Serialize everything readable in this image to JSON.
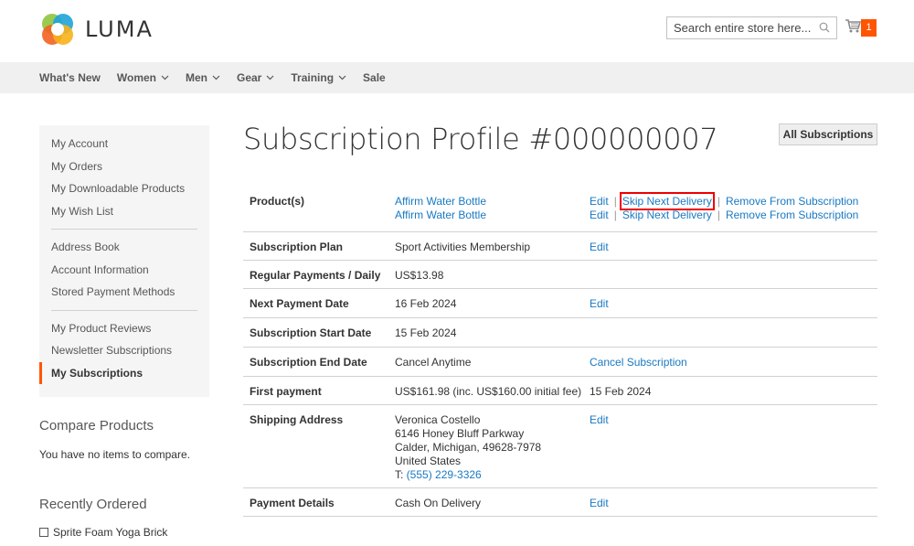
{
  "header": {
    "logo_text": "LUMA",
    "search_placeholder": "Search entire store here...",
    "cart_count": "1"
  },
  "nav": {
    "items": [
      {
        "label": "What's New",
        "dropdown": false
      },
      {
        "label": "Women",
        "dropdown": true
      },
      {
        "label": "Men",
        "dropdown": true
      },
      {
        "label": "Gear",
        "dropdown": true
      },
      {
        "label": "Training",
        "dropdown": true
      },
      {
        "label": "Sale",
        "dropdown": false
      }
    ]
  },
  "sidebar": {
    "group1": [
      "My Account",
      "My Orders",
      "My Downloadable Products",
      "My Wish List"
    ],
    "group2": [
      "Address Book",
      "Account Information",
      "Stored Payment Methods"
    ],
    "group3": [
      "My Product Reviews",
      "Newsletter Subscriptions",
      "My Subscriptions"
    ],
    "active": "My Subscriptions"
  },
  "compare": {
    "title": "Compare Products",
    "text": "You have no items to compare."
  },
  "recent": {
    "title": "Recently Ordered",
    "item": "Sprite Foam Yoga Brick"
  },
  "main": {
    "title": "Subscription Profile #000000007",
    "all_subscriptions_label": "All Subscriptions",
    "products_label": "Product(s)",
    "products": [
      {
        "name": "Affirm Water Bottle",
        "edit": "Edit",
        "skip": "Skip Next Delivery",
        "remove": "Remove From Subscription"
      },
      {
        "name": "Affirm Water Bottle",
        "edit": "Edit",
        "skip": "Skip Next Delivery",
        "remove": "Remove From Subscription"
      }
    ],
    "plan_label": "Subscription Plan",
    "plan_value": "Sport Activities Membership",
    "plan_action": "Edit",
    "regular_label": "Regular Payments / Daily",
    "regular_value": "US$13.98",
    "next_label": "Next Payment Date",
    "next_value": "16 Feb 2024",
    "next_action": "Edit",
    "start_label": "Subscription Start Date",
    "start_value": "15 Feb 2024",
    "end_label": "Subscription End Date",
    "end_value": "Cancel Anytime",
    "end_action": "Cancel Subscription",
    "first_label": "First payment",
    "first_value": "US$161.98 (inc. US$160.00 initial fee)",
    "first_date": "15 Feb 2024",
    "shipping_label": "Shipping Address",
    "shipping_lines": [
      "Veronica Costello",
      "6146 Honey Bluff Parkway",
      "Calder, Michigan, 49628-7978",
      "United States"
    ],
    "phone_prefix": "T: ",
    "phone": "(555) 229-3326",
    "shipping_action": "Edit",
    "payment_label": "Payment Details",
    "payment_value": "Cash On Delivery",
    "payment_action": "Edit"
  },
  "colors": {
    "accent": "#ff5501",
    "link": "#1979c3",
    "highlight": "#e00000"
  }
}
